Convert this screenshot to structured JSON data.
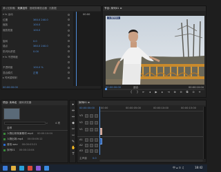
{
  "effect_controls": {
    "tabs": [
      "源:(无剪辑)",
      "效果控件",
      "音频剪辑混合器",
      "元数据"
    ],
    "rows": [
      {
        "label": "▾ fx 运动",
        "value": ""
      },
      {
        "label": "位置",
        "value": "360.0  240.0"
      },
      {
        "label": "缩放",
        "value": "100.0"
      },
      {
        "label": "缩放宽度",
        "value": "100.0"
      },
      {
        "label": "",
        "value": ""
      },
      {
        "label": "旋转",
        "value": "0.0"
      },
      {
        "label": "锚点",
        "value": "360.0  240.0"
      },
      {
        "label": "防闪烁滤镜",
        "value": "0.00"
      },
      {
        "label": "▾ fx 不透明度",
        "value": ""
      },
      {
        "label": "",
        "value": ""
      },
      {
        "label": "不透明度",
        "value": "100.0 %"
      },
      {
        "label": "混合模式",
        "value": "正常"
      },
      {
        "label": "▸ 时间重映射",
        "value": ""
      }
    ],
    "right_value": "00:00",
    "timecode": "00:00:00:00"
  },
  "program_monitor": {
    "tab": "节目: 序列01 ≡",
    "clip_label": "1 序列01",
    "timecode": "00:00:00:00",
    "fit_label": "适合",
    "duration": "00:00:10:04",
    "transport": [
      "{",
      "}",
      "⇤",
      "◂",
      "▶",
      "▸",
      "⇥",
      "⊕",
      "⊖",
      "⧉",
      "⊙",
      "+"
    ]
  },
  "project": {
    "tabs": [
      "项目: 未命名",
      "媒体浏览器"
    ],
    "search_placeholder": "",
    "item_count": "4 项",
    "column_header": "名称",
    "files": [
      {
        "name": "人物出场背景素材.mp4",
        "color": "#3a8a3a",
        "duration": "00:00:10:04"
      },
      {
        "name": "人物出场.mp4",
        "color": "#3a8a3a",
        "duration": "00:00:06:12"
      },
      {
        "name": "音效.wav",
        "color": "#2a6ad0",
        "duration": "00:00:03:21"
      },
      {
        "name": "序列01",
        "color": "#3a8a3a",
        "duration": "00:00:10:04"
      }
    ]
  },
  "timeline": {
    "tab": "序列01 ≡",
    "timecode": "00:00:00:00",
    "ruler_labels": [
      "00:00",
      "00:00:05:00",
      "00:00:10:00",
      "00:00:15:00"
    ],
    "tracks": [
      {
        "name": "V3"
      },
      {
        "name": "V2"
      },
      {
        "name": "V1"
      },
      {
        "name": "A1"
      },
      {
        "name": "A2"
      },
      {
        "name": "A3"
      }
    ],
    "mix_label": "主声道",
    "mix_value": "0.0"
  },
  "tools": [
    "▸",
    "⇹",
    "⇔",
    "◆",
    "✂",
    "⇿",
    "✎",
    "✋",
    "T"
  ],
  "taskbar": {
    "icons": [
      {
        "name": "windows-start-icon",
        "color": "#3a7ad8"
      },
      {
        "name": "file-explorer-icon",
        "color": "#e0b040"
      },
      {
        "name": "browser-icon",
        "color": "#2aa0d8"
      },
      {
        "name": "media-icon",
        "color": "#d84a3a"
      },
      {
        "name": "premiere-icon",
        "color": "#8a5ad8"
      },
      {
        "name": "app-icon-blue",
        "color": "#3a8ae0"
      }
    ],
    "tray": "中 ▴ ⊡ ♫",
    "clock": "18:42"
  }
}
